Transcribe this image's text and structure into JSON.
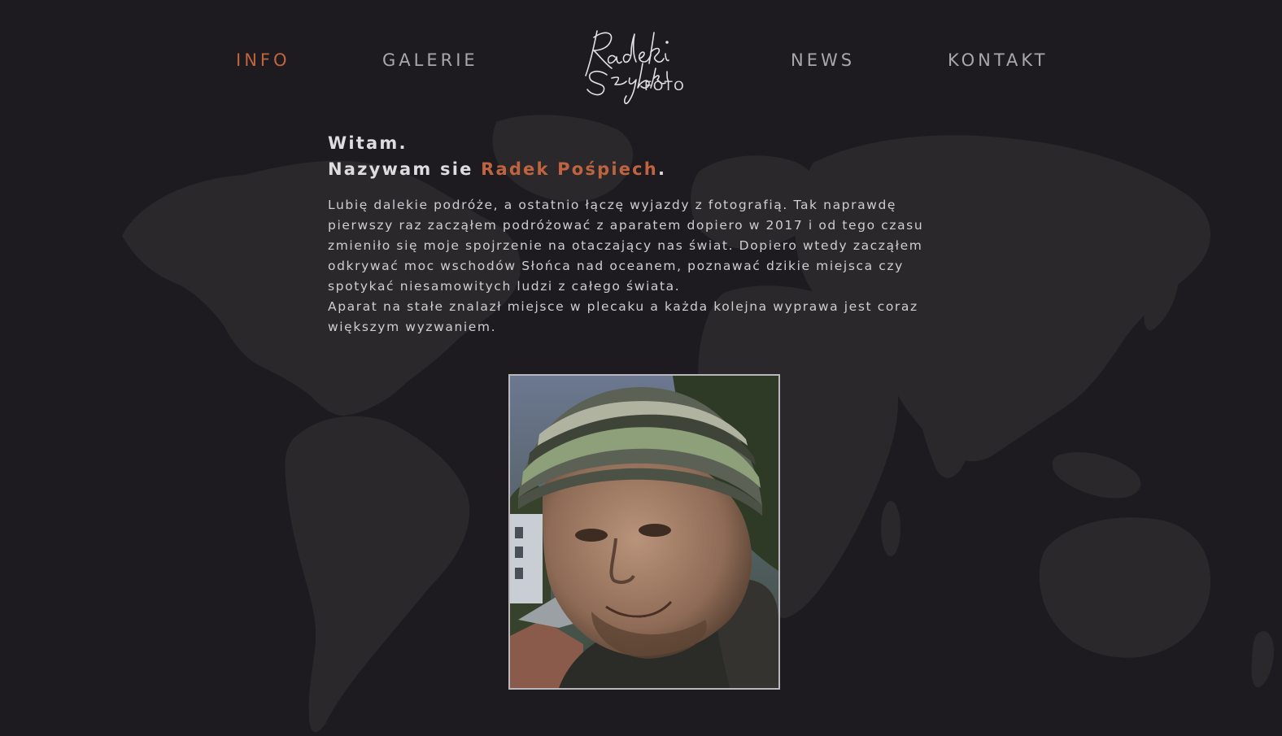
{
  "nav": {
    "items": [
      {
        "label": "INFO",
        "active": true
      },
      {
        "label": "GALERIE",
        "active": false
      },
      {
        "label": "NEWS",
        "active": false
      },
      {
        "label": "KONTAKT",
        "active": false
      }
    ],
    "logo": {
      "script_text": "Radek Szybki",
      "suffix": "FOTO"
    }
  },
  "intro": {
    "line1": "Witam.",
    "line2_prefix": "Nazywam sie ",
    "name": "Radek Pośpiech",
    "line2_suffix": "."
  },
  "bio": {
    "paragraph1": "Lubię dalekie podróże, a ostatnio łączę wyjazdy z fotografią. Tak naprawdę pierwszy raz zacząłem podróżować z aparatem dopiero w 2017 i od tego czasu zmieniło się moje spojrzenie na otaczający nas świat. Dopiero wtedy zacząłem odkrywać moc wschodów Słońca nad oceanem, poznawać dzikie miejsca czy spotykać niesamowitych ludzi z całego świata.",
    "paragraph2": "Aparat na stałe znalazł miejsce w plecaku a każda kolejna wyprawa jest coraz większym wyzwaniem."
  },
  "colors": {
    "background": "#1d1b1f",
    "accent": "#c0643f",
    "nav_text": "#a9a7ab",
    "map": "#2a282b"
  }
}
